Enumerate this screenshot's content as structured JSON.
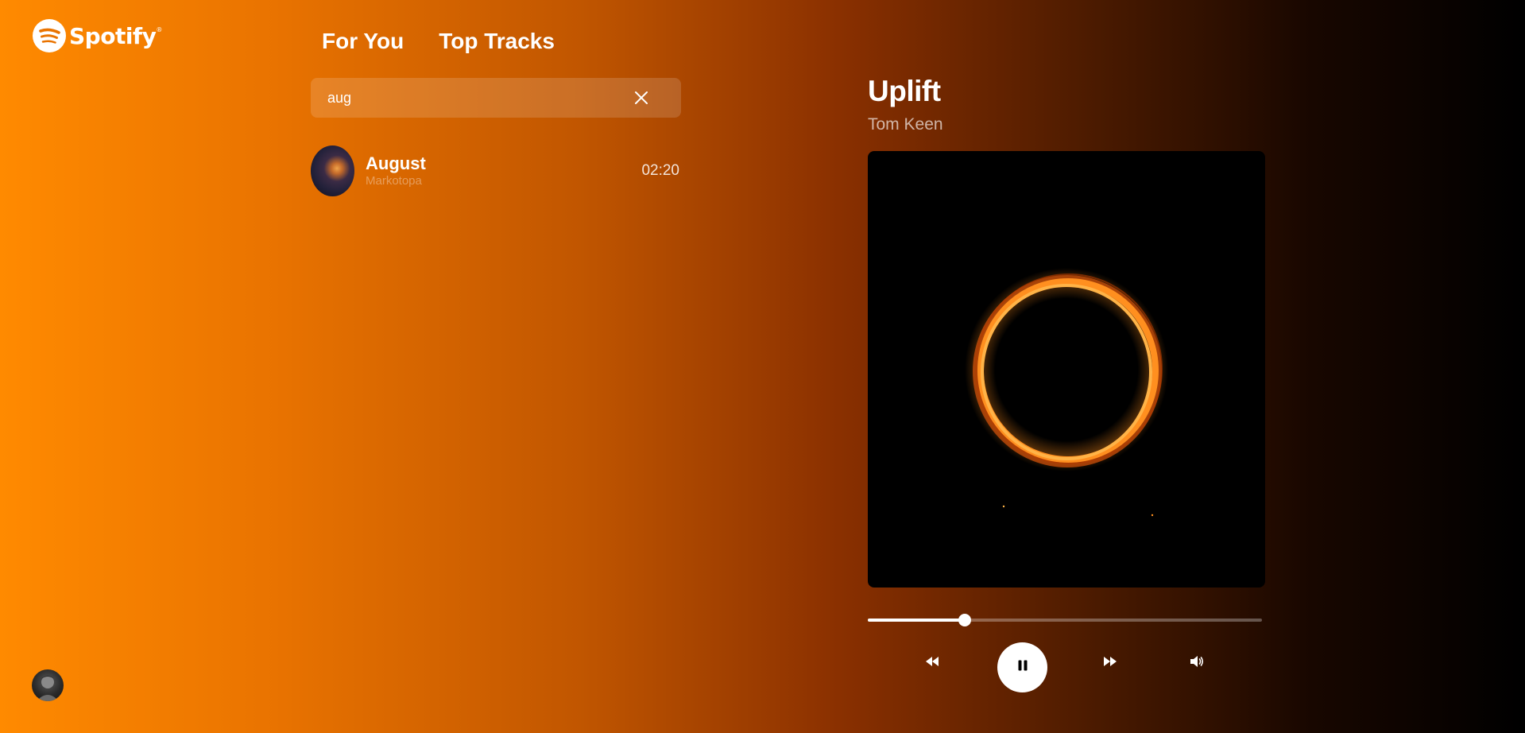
{
  "brand": {
    "name": "Spotify",
    "mark": "®",
    "color": "#ffffff"
  },
  "tabs": [
    {
      "label": "For You"
    },
    {
      "label": "Top Tracks"
    }
  ],
  "search": {
    "value": "aug",
    "clear_icon": "close-icon"
  },
  "results": [
    {
      "title": "August",
      "artist": "Markotopa",
      "duration": "02:20"
    }
  ],
  "now_playing": {
    "title": "Uplift",
    "artist": "Tom Keen",
    "progress_fraction": 0.245
  },
  "controls": {
    "prev_icon": "rewind-icon",
    "play_icon": "pause-icon",
    "next_icon": "fast-forward-icon",
    "volume_icon": "volume-icon"
  },
  "colors": {
    "gradient_start": "#ff8a00",
    "gradient_end": "#000000",
    "accent": "#ffffff"
  }
}
